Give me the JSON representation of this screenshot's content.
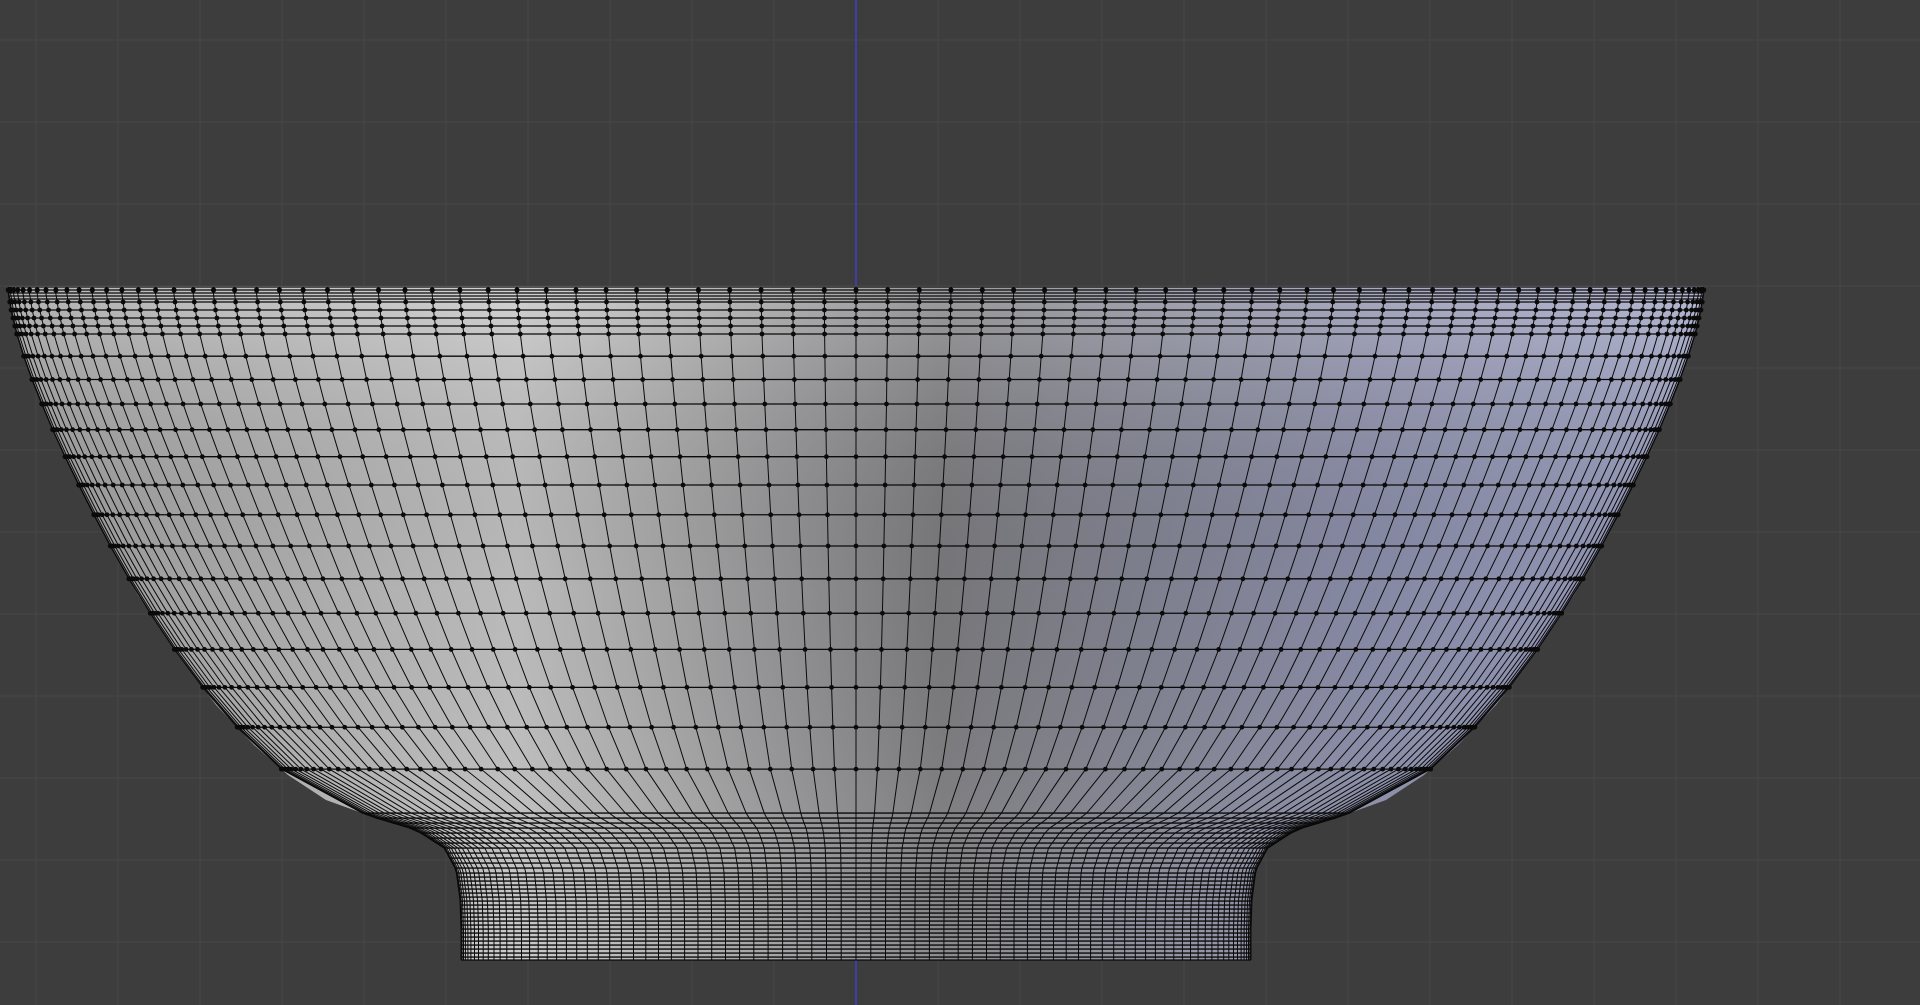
{
  "viewport": {
    "view_mode": "front-orthographic",
    "grid": true,
    "background_color": "#3d3d3d",
    "grid_color": "#474747",
    "z_axis_color": "#3f3fc9",
    "object": {
      "type": "bowl-mesh",
      "selected_mode": "vertex",
      "wire_color": "#0a0a0a",
      "shade_light": "#d2d2d2",
      "shade_mid": "#8a8a8e",
      "shade_blue": "#a7abc9"
    }
  }
}
